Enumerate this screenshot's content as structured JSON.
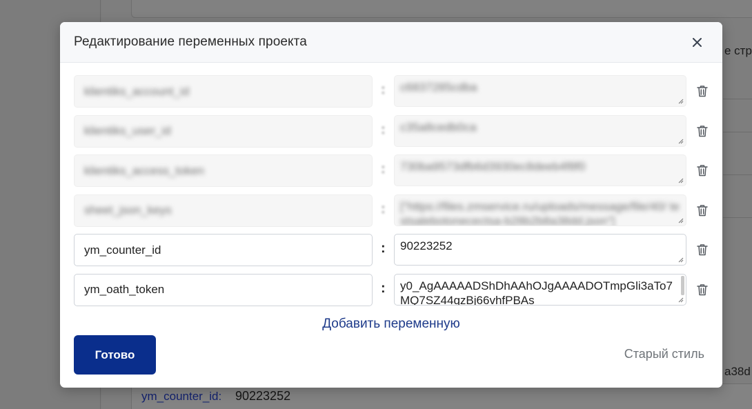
{
  "background": {
    "right_text_1": "е стро",
    "right_text_2": "a38d",
    "var_label": "ym_counter_id:",
    "var_value": "90223252"
  },
  "modal": {
    "title": "Редактирование переменных проекта",
    "rows": [
      {
        "key": "klientiks_account_id",
        "value": "c6837285cdba",
        "blurred": true
      },
      {
        "key": "klientiks_user_id",
        "value": "c35a8cedb0ca",
        "blurred": true
      },
      {
        "key": "klientiks_access_token",
        "value": "730ba9573dfb6d3930ec8deeb4f8f0",
        "blurred": true
      },
      {
        "key": "sheet_json_keys",
        "value": "[\"https://files.zmservice.ru/uploads/message/file/40/ testsalebotonecectsa-b28b2b8a38dd.json\"]",
        "blurred": true
      },
      {
        "key": "ym_counter_id",
        "value": "90223252",
        "blurred": false
      },
      {
        "key": "ym_oath_token",
        "value": "y0_AgAAAAADShDhAAhOJgAAAADOTmpGli3aTo7MQ7SZ44qzBj66vhfPBAs",
        "blurred": false
      }
    ],
    "add_label": "Добавить переменную",
    "done_label": "Готово",
    "old_style_label": "Старый стиль"
  },
  "colors": {
    "primary": "#0a2e8c",
    "link": "#1d3a8a",
    "overlay": "#7f7f7f"
  }
}
